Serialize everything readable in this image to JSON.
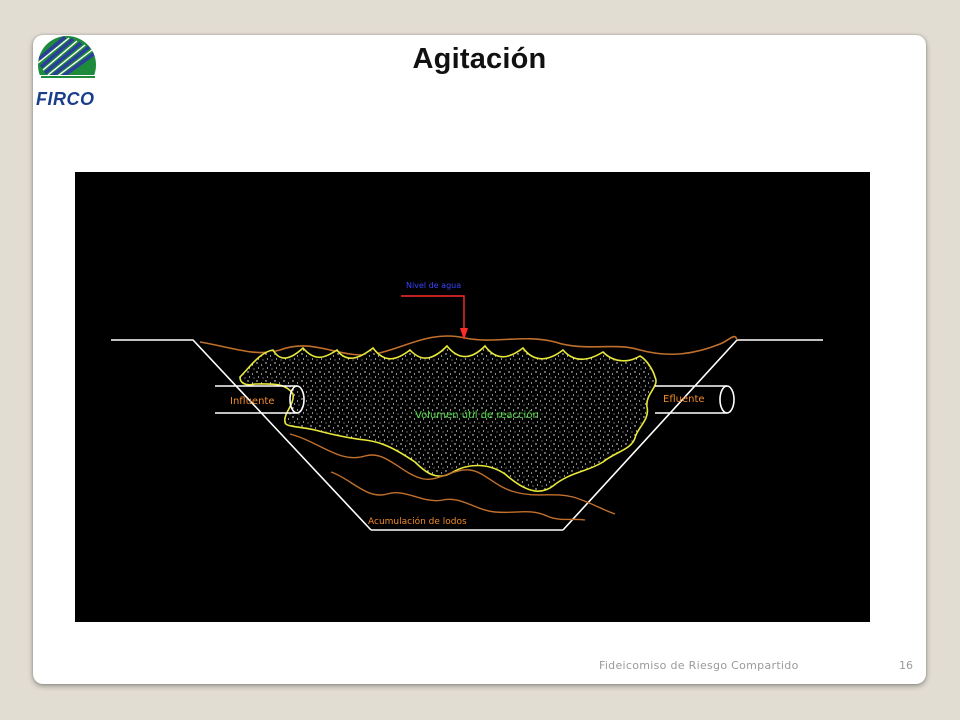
{
  "slide": {
    "title": "Agitación",
    "logo_text": "FIRCO",
    "footer": "Fideicomiso de Riesgo Compartido",
    "page_number": "16"
  },
  "diagram": {
    "labels": {
      "water_level": "Nivel de agua",
      "influent": "Influente",
      "effluent": "Efluente",
      "reaction_volume": "Volumen útil de reacción",
      "sludge": "Acumulación de lodos"
    },
    "colors": {
      "background": "#000000",
      "banks": "#ffffff",
      "water_line": "#c0702c",
      "reaction_outline": "#e8e83a",
      "label_orange": "#f08a2a",
      "label_green": "#55e04a",
      "label_blue": "#3a44ff",
      "arrow_red": "#ff2a2a"
    }
  }
}
